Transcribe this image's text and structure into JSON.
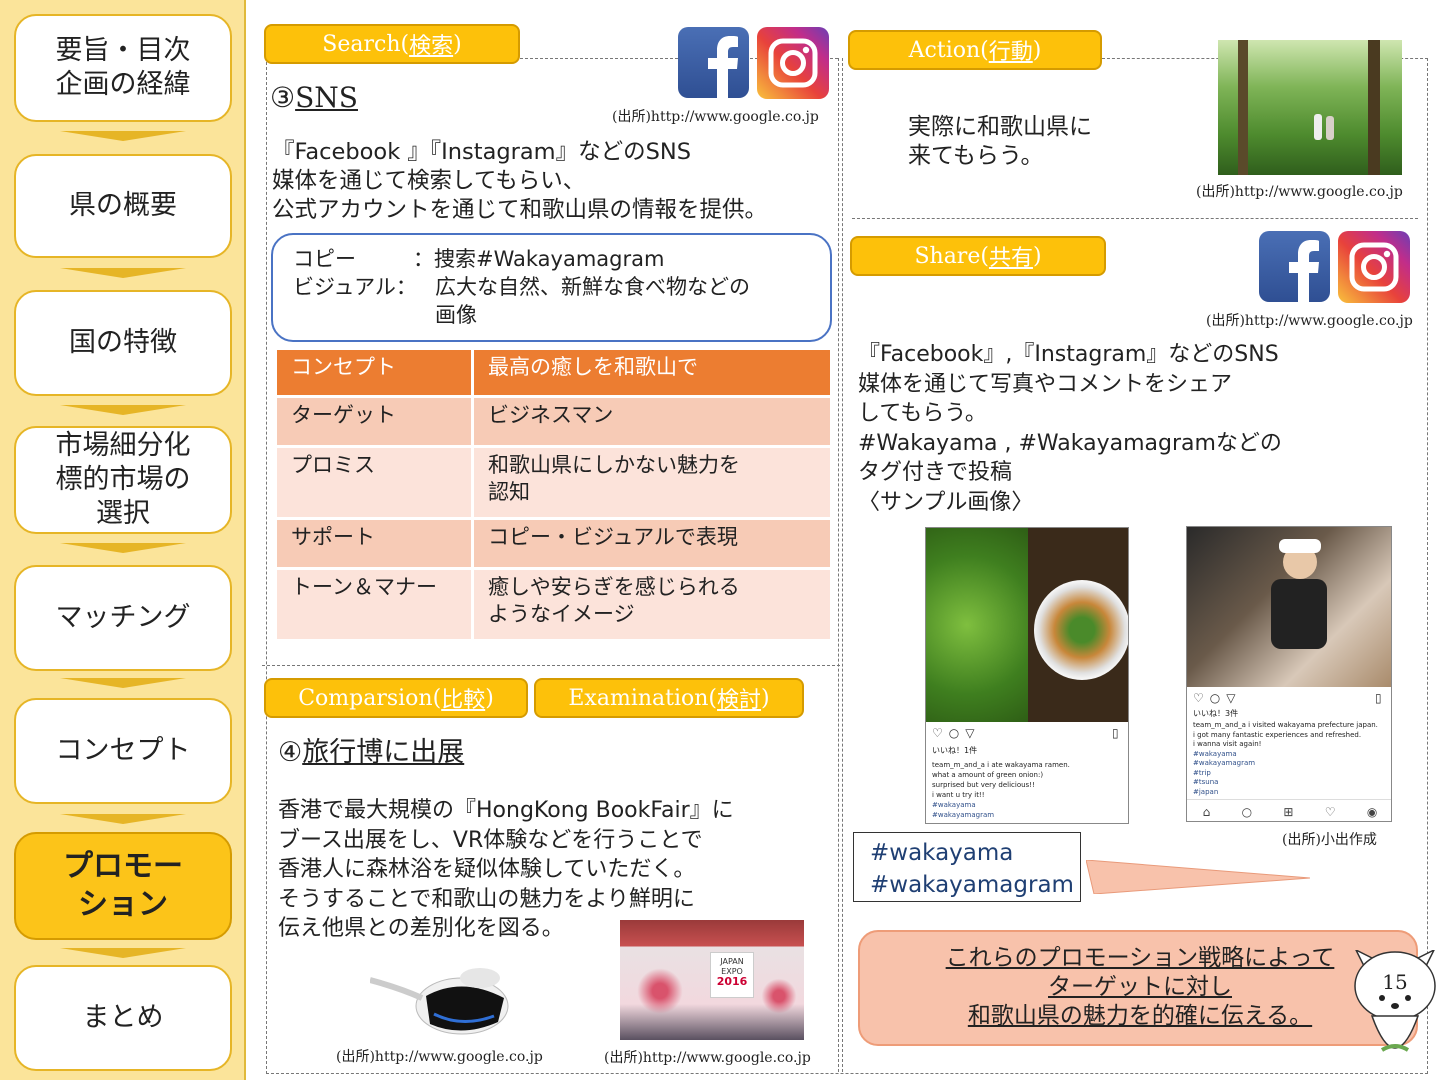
{
  "sidebar": {
    "items": [
      {
        "label": "要旨・目次\n企画の経緯"
      },
      {
        "label": "県の概要"
      },
      {
        "label": "国の特徴"
      },
      {
        "label": "市場細分化\n標的市場の\n選択"
      },
      {
        "label": "マッチング"
      },
      {
        "label": "コンセプト"
      },
      {
        "label": "プロモー\nション"
      },
      {
        "label": "まとめ"
      }
    ]
  },
  "search": {
    "tab_prefix": "Search(",
    "tab_kanji": "検索",
    "tab_suffix": ")",
    "heading_number": "③",
    "heading": "SNS",
    "source": "(出所)http://www.google.co.jp",
    "body": "『Facebook 』『Instagram』などのSNS\n  媒体を通じて検索してもらい、\n  公式アカウントを通じて和歌山県の情報を提供。",
    "copy_label": "コピー",
    "copy_value": "：捜索#Wakayamagram",
    "visual_label": "ビジュアル：",
    "visual_value": "広大な自然、新鮮な食べ物などの\n画像"
  },
  "concept_table": {
    "rows": [
      {
        "key": "コンセプト",
        "value": "最高の癒しを和歌山で"
      },
      {
        "key": "ターゲット",
        "value": "ビジネスマン"
      },
      {
        "key": "プロミス",
        "value": "和歌山県にしかない魅力を\n認知"
      },
      {
        "key": "サポート",
        "value": "コピー・ビジュアルで表現"
      },
      {
        "key": "トーン＆マナー",
        "value": "癒しや安らぎを感じられる\nようなイメージ"
      }
    ]
  },
  "comparison": {
    "tab1_prefix": "Comparsion(",
    "tab1_kanji": "比較",
    "tab2_prefix": "Examination(",
    "tab2_kanji": "検討",
    "tab_suffix": ")",
    "heading_number": "④",
    "heading": "旅行博に出展",
    "body": "香港で最大規模の『HongKong BookFair』に\nブース出展をし、VR体験などを行うことで\n香港人に森林浴を疑似体験していただく。\nそうすることで和歌山の魅力をより鮮明に\n伝え他県との差別化を図る。",
    "source1": "(出所)http://www.google.co.jp",
    "source2": "(出所)http://www.google.co.jp",
    "expo_sign": "JAPAN EXPO",
    "expo_year": "2016"
  },
  "action": {
    "tab_prefix": "Action(",
    "tab_kanji": "行動",
    "tab_suffix": ")",
    "body": "実際に和歌山県に\n来てもらう。",
    "source": "(出所)http://www.google.co.jp"
  },
  "share": {
    "tab_prefix": "Share(",
    "tab_kanji": "共有",
    "tab_suffix": ")",
    "source": "(出所)http://www.google.co.jp",
    "body": "『Facebook』,『Instagram』などのSNS\n  媒体を通じて写真やコメントをシェア\n  してもらう。\n  #Wakayama , #Wakayamagramなどの\n  タグ付きで投稿\n〈サンプル画像〉",
    "post1": {
      "likes": "いいね！1件",
      "lines": [
        "team_m_and_a i ate wakayama ramen.",
        "what a amount of green onion:)",
        "surprised but very delicious!!",
        "i want u try it!!"
      ],
      "tags": [
        "#wakayama",
        "#wakayamagram"
      ]
    },
    "post2": {
      "likes": "いいね！3件",
      "lines": [
        "team_m_and_a i visited wakayama prefecture japan.",
        "i got many fantastic experiences and refreshed.",
        "i wanna visit again!"
      ],
      "tags": [
        "#wakayama",
        "#wakayamagram",
        "#trip",
        "#tsuna",
        "#japan"
      ]
    },
    "own_source": "(出所)小出作成",
    "hashtag1": "#wakayama",
    "hashtag2": "#wakayamagram",
    "conclusion": "これらのプロモーション戦略によって\nターゲットに対し\n和歌山県の魅力を的確に伝える。"
  },
  "page_number": "15",
  "colors": {
    "accent": "#fdc10a",
    "sidebar": "#fbe49a",
    "table_head": "#ec7d31",
    "conclusion": "#f8c2ab"
  }
}
